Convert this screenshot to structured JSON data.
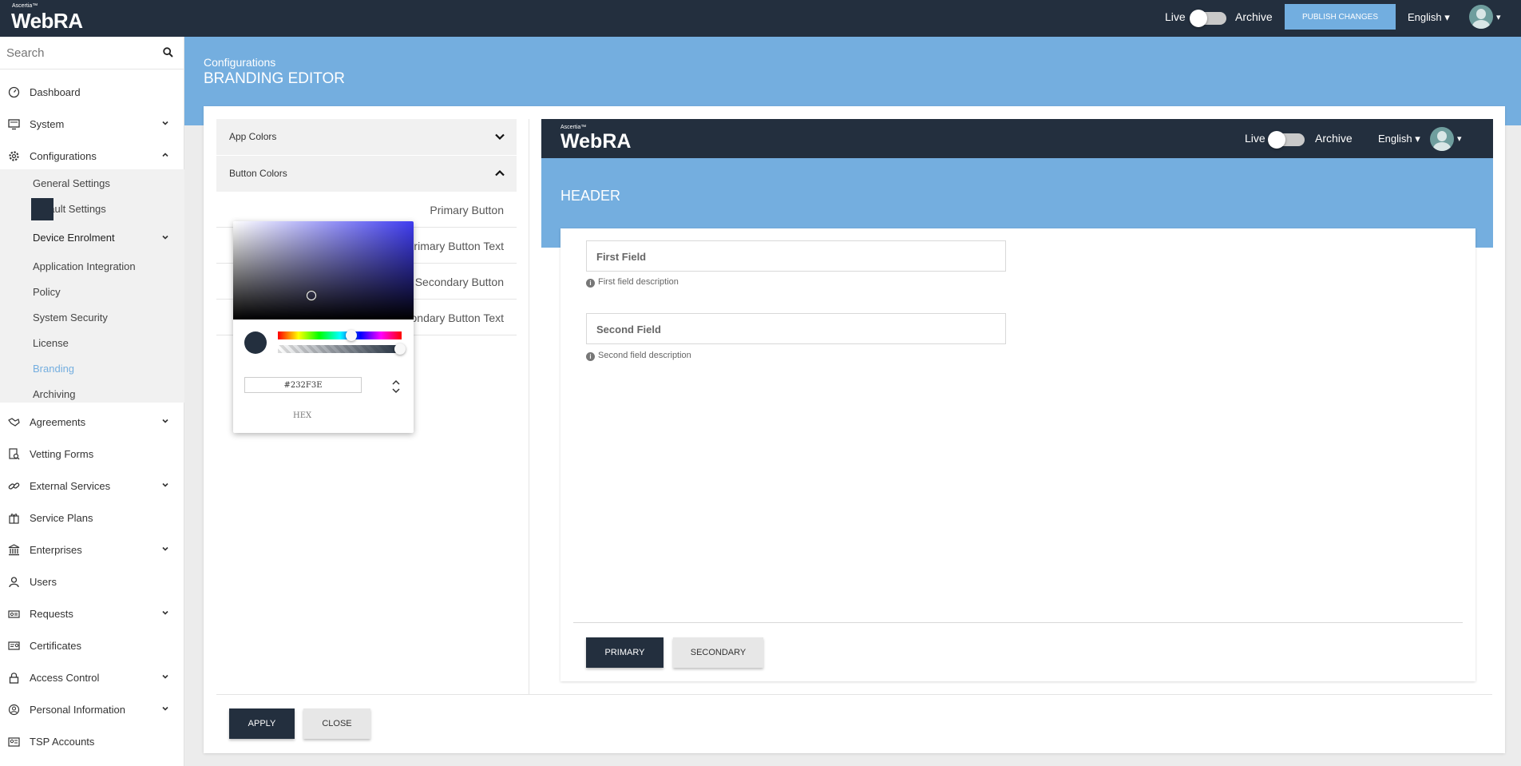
{
  "app": {
    "logo_small": "Ascertia™",
    "logo_big": "WebRA",
    "live_label": "Live",
    "archive_label": "Archive",
    "publish_label": "PUBLISH CHANGES",
    "language": "English ▾",
    "avatar_caret": "▾"
  },
  "sidebar": {
    "search_placeholder": "Search",
    "items": [
      {
        "label": "Dashboard",
        "icon": "dashboard-icon"
      },
      {
        "label": "System",
        "icon": "monitor-icon",
        "expand": "chevron-down"
      },
      {
        "label": "Configurations",
        "icon": "gear-icon",
        "expand": "chevron-up"
      },
      {
        "label": "Agreements",
        "icon": "handshake-icon",
        "expand": "chevron-down"
      },
      {
        "label": "Vetting Forms",
        "icon": "vetting-icon"
      },
      {
        "label": "External Services",
        "icon": "link-icon",
        "expand": "chevron-down"
      },
      {
        "label": "Service Plans",
        "icon": "gift-icon"
      },
      {
        "label": "Enterprises",
        "icon": "bank-icon",
        "expand": "chevron-down"
      },
      {
        "label": "Users",
        "icon": "user-icon"
      },
      {
        "label": "Requests",
        "icon": "requests-icon",
        "expand": "chevron-down"
      },
      {
        "label": "Certificates",
        "icon": "certificate-icon"
      },
      {
        "label": "Access Control",
        "icon": "lock-icon",
        "expand": "chevron-down"
      },
      {
        "label": "Personal Information",
        "icon": "person-circle-icon",
        "expand": "chevron-down"
      },
      {
        "label": "TSP Accounts",
        "icon": "id-card-icon"
      }
    ],
    "subitems": [
      "General Settings",
      "Default Settings",
      "Device Enrolment",
      "Application Integration",
      "Policy",
      "System Security",
      "License",
      "Branding",
      "Archiving"
    ],
    "active_sub": "Branding",
    "active_color": "#74aedf"
  },
  "page": {
    "breadcrumb": "Configurations",
    "title": "BRANDING EDITOR"
  },
  "editor": {
    "sections": [
      "App Colors",
      "Button Colors"
    ],
    "color_rows": [
      "Primary Button",
      "Primary Button Text",
      "Secondary Button",
      "Secondary Button Text"
    ],
    "apply_label": "APPLY",
    "close_label": "CLOSE"
  },
  "picker": {
    "hex_value": "#232F3E",
    "mode_label": "HEX"
  },
  "preview": {
    "logo_small": "Ascertia™",
    "logo_big": "WebRA",
    "live_label": "Live",
    "archive_label": "Archive",
    "language": "English ▾",
    "avatar_caret": "▾",
    "header_title": "HEADER",
    "fields": [
      {
        "label": "First Field",
        "description": "First field description"
      },
      {
        "label": "Second Field",
        "description": "Second field description"
      }
    ],
    "primary_label": "PRIMARY",
    "secondary_label": "SECONDARY"
  },
  "colors": {
    "dark": "#232f3e",
    "accent": "#74aedf"
  }
}
